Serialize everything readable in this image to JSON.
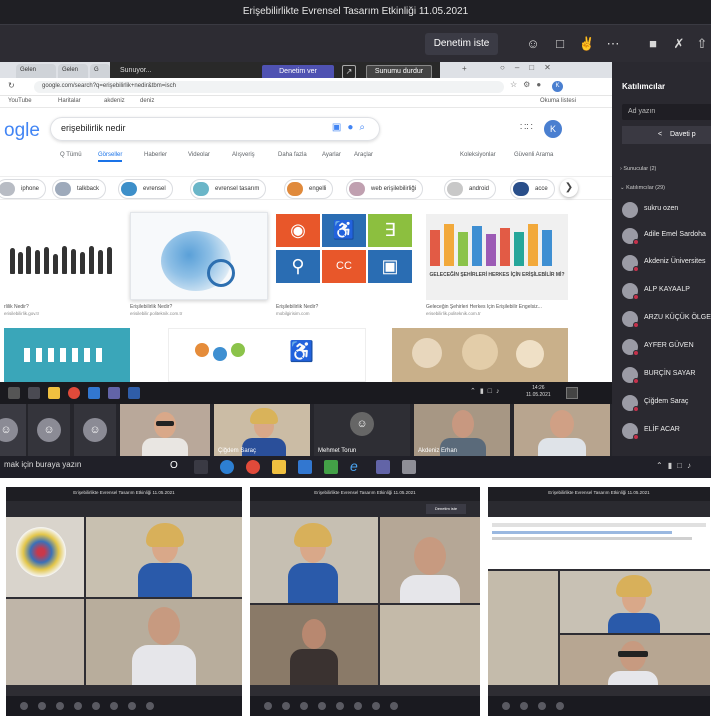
{
  "teams": {
    "window_title": "Erişebilirlikte Evrensel Tasarım Etkinliği 11.05.2021",
    "denetim_button": "Denetim iste",
    "toolbar_icons": [
      "people-icon",
      "chat-icon",
      "reactions-icon",
      "more-icon",
      "camera-icon",
      "mic-off-icon",
      "share-icon"
    ]
  },
  "share_bar": {
    "status": "Sunuyor...",
    "denetim": "Denetim ver",
    "stop": "Sunumu durdur"
  },
  "browser": {
    "tabs": [
      "Gelen",
      "Gelen",
      "G"
    ],
    "url": "google.com/search?q=erişebilirlik+nedir&tbm=isch",
    "bookmarks": [
      "YouTube",
      "Haritalar",
      "akdeniz",
      "deniz"
    ],
    "bookmarks_right": "Okuma listesi",
    "logo": "ogle",
    "query": "erişebilirlik nedir",
    "avatar_letter": "K",
    "search_tabs": [
      "Q Tümü",
      "Görseller",
      "Haberler",
      "Videolar",
      "Alışveriş",
      "Daha fazla",
      "Ayarlar",
      "Araçlar"
    ],
    "search_tabs_right": [
      "Koleksiyonlar",
      "Güvenli Arama"
    ],
    "chips": [
      "iphone",
      "talkback",
      "evrensel",
      "evrensel tasarım",
      "engelli",
      "web erişilebilirliği",
      "android",
      "acce"
    ],
    "results": [
      {
        "caption": "rlilik Nedir?",
        "source": "erisilebilirlik.gov.tr"
      },
      {
        "caption": "Erişilebilirlik Nedir?",
        "source": "erisilebilir.politeknik.com.tr"
      },
      {
        "caption": "Erişilebilirlik Nedir?",
        "source": "mobilgirisim.com"
      },
      {
        "caption": "Geleceğin Şehirleri Herkes İçin Erişilebilir Engelsiz...",
        "source": "erisebilirlik.politeknik.com.tr"
      }
    ],
    "banner_text": "GELECEĞİN ŞEHİRLERİ HERKES İÇİN ERİŞİLEBİLİR Mİ?"
  },
  "taskbar1": {
    "time": "14:26",
    "date": "11.05.2021"
  },
  "video_strip": {
    "tiles": [
      "",
      "",
      "",
      "Çiğdem Saraç",
      "Mehmet Torun",
      "Akdeniz Erhan"
    ]
  },
  "taskbar2": {
    "search": "mak için buraya yazın"
  },
  "panel": {
    "title": "Katılımcılar",
    "search_placeholder": "Ad yazın",
    "invite": "Daveti p",
    "presenters": "Sunucular (2)",
    "attendees": "Katılımcılar (29)",
    "people": [
      "sukru ozen",
      "Adile Emel Sardoha",
      "Akdeniz Üniversites",
      "ALP KAYAALP",
      "ARZU KÜÇÜK ÖLGE",
      "AYFER GÜVEN",
      "BURÇİN SAYAR",
      "Çiğdem Saraç",
      "ELİF ACAR"
    ]
  },
  "bottom_shots": {
    "titles": [
      "Erişebilirlikte Evrensel Tasarım Etkinliği 11.05.2021",
      "Erişebilirlikte Evrensel Tasarım Etkinliği 11.05.2021",
      "Erişebilirlikte Evrensel Tasarım Etkinliği 11.05.2021"
    ],
    "label": "Denetim iste"
  }
}
